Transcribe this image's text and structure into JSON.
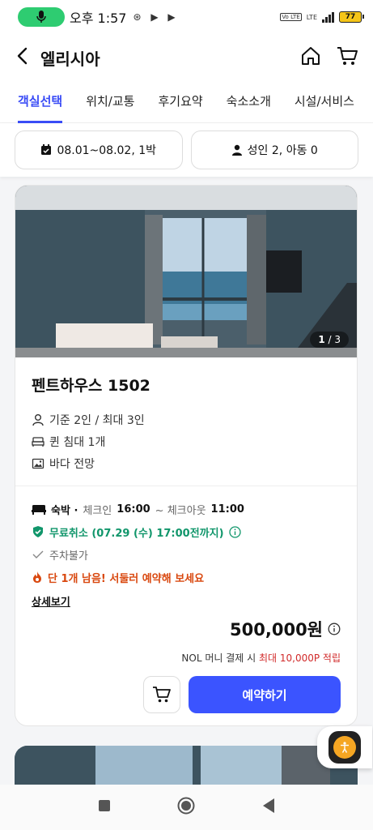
{
  "status_bar": {
    "time": "오후 1:57",
    "glyphs": "⊛ ▶ ▶",
    "net_tag": "Vo LTE",
    "lte": "LTE",
    "battery": "77"
  },
  "header": {
    "title": "엘리시아"
  },
  "tabs": [
    {
      "label": "객실선택"
    },
    {
      "label": "위치/교통"
    },
    {
      "label": "후기요약"
    },
    {
      "label": "숙소소개"
    },
    {
      "label": "시설/서비스"
    }
  ],
  "filters": {
    "dates": "08.01~08.02, 1박",
    "guests": "성인 2, 아동 0"
  },
  "room": {
    "image_index": "1",
    "image_total": "/ 3",
    "name": "펜트하우스 1502",
    "features": [
      {
        "icon": "person-icon",
        "label": "기준 2인 / 최대 3인"
      },
      {
        "icon": "bed-icon",
        "label": "퀸 침대 1개"
      },
      {
        "icon": "image-icon",
        "label": "바다 전망"
      }
    ],
    "stay_type": "숙박 ·",
    "checkin_label": "체크인",
    "checkin_time": "16:00",
    "checkout_label": "~ 체크아웃",
    "checkout_time": "11:00",
    "free_cancel": "무료취소 (07.29 (수) 17:00전까지)",
    "parking": "주차불가",
    "urgency": "단 1개 남음! 서둘러 예약해 보세요",
    "detail_link": "상세보기",
    "price": "500,000원",
    "points_prefix": "NOL 머니 결제 시",
    "points_highlight": "최대 10,000P 적립",
    "reserve_label": "예약하기"
  },
  "colors": {
    "accent": "#3a4cf6",
    "button": "#3b54ff",
    "green": "#11966b",
    "orange": "#d9480f",
    "red": "#d12a2a",
    "mic": "#2ecc71",
    "a11y": "#f5a623"
  }
}
